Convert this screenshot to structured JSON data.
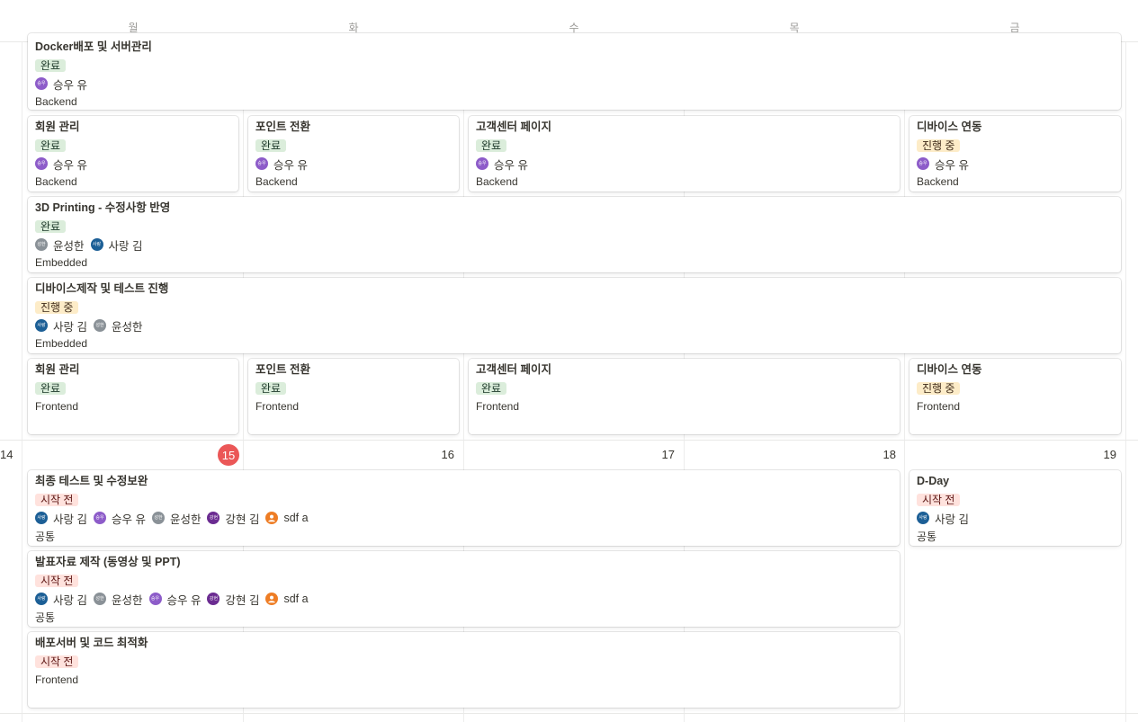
{
  "days": [
    "월",
    "화",
    "수",
    "목",
    "금"
  ],
  "colors": {
    "today": "#eb5757",
    "done_tag": "#dbeddb",
    "progress_tag": "#fdecc8",
    "todo_tag": "#ffe2dd"
  },
  "week1": {
    "cards": [
      {
        "title": "Docker배포 및 서버관리",
        "status": "완료",
        "people": [
          "승우 유"
        ],
        "category": "Backend"
      },
      {
        "title": "회원 관리",
        "status": "완료",
        "people": [
          "승우 유"
        ],
        "category": "Backend"
      },
      {
        "title": "포인트 전환",
        "status": "완료",
        "people": [
          "승우 유"
        ],
        "category": "Backend"
      },
      {
        "title": "고객센터 페이지",
        "status": "완료",
        "people": [
          "승우 유"
        ],
        "category": "Backend"
      },
      {
        "title": "디바이스 연동",
        "status": "진행 중",
        "people": [
          "승우 유"
        ],
        "category": "Backend"
      },
      {
        "title": "3D Printing - 수정사항 반영",
        "status": "완료",
        "people": [
          "윤성한",
          "사랑 김"
        ],
        "category": "Embedded"
      },
      {
        "title": "디바이스제작 및 테스트 진행",
        "status": "진행 중",
        "people": [
          "사랑 김",
          "윤성한"
        ],
        "category": "Embedded"
      },
      {
        "title": "회원 관리",
        "status": "완료",
        "category": "Frontend"
      },
      {
        "title": "포인트 전환",
        "status": "완료",
        "category": "Frontend"
      },
      {
        "title": "고객센터 페이지",
        "status": "완료",
        "category": "Frontend"
      },
      {
        "title": "디바이스 연동",
        "status": "진행 중",
        "category": "Frontend"
      }
    ]
  },
  "week2": {
    "week_number": "14",
    "dates": [
      "15",
      "16",
      "17",
      "18",
      "19"
    ],
    "cards": [
      {
        "title": "최종 테스트 및 수정보완",
        "status": "시작 전",
        "people": [
          "사랑 김",
          "승우 유",
          "윤성한",
          "강현 김",
          "sdf a"
        ],
        "category": "공통"
      },
      {
        "title": "D-Day",
        "status": "시작 전",
        "people": [
          "사랑 김"
        ],
        "category": "공통"
      },
      {
        "title": "발표자료 제작 (동영상 및 PPT)",
        "status": "시작 전",
        "people": [
          "사랑 김",
          "윤성한",
          "승우 유",
          "강현 김",
          "sdf a"
        ],
        "category": "공통"
      },
      {
        "title": "배포서버 및 코드 최적화",
        "status": "시작 전",
        "category": "Frontend"
      }
    ]
  },
  "avatar_initials": {
    "su": "승우",
    "yun": "성한",
    "sarang": "사랑",
    "kang": "강현"
  }
}
